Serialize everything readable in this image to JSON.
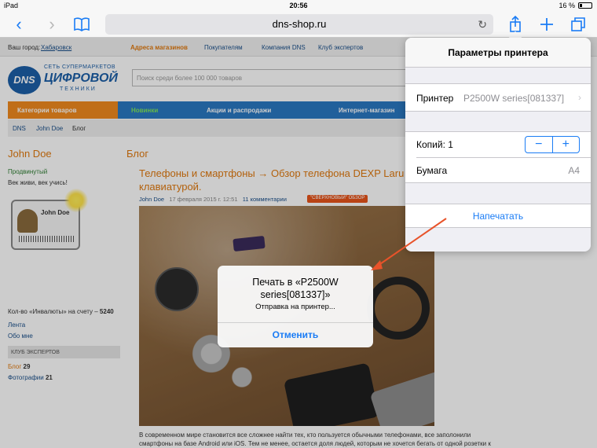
{
  "status_bar": {
    "device": "iPad",
    "time": "20:56",
    "battery": "16 %"
  },
  "browser": {
    "url": "dns-shop.ru",
    "icons": [
      "back-icon",
      "forward-icon",
      "bookmarks-icon",
      "reload-icon",
      "share-icon",
      "new-tab-icon",
      "tabs-icon"
    ]
  },
  "webpage": {
    "topnav": {
      "city_label": "Ваш город:",
      "city": "Хабаровск",
      "items": [
        "Адреса магазинов",
        "Покупателям",
        "Компания DNS",
        "Клуб экспертов"
      ]
    },
    "logo": {
      "brand": "DNS",
      "line1": "СЕТЬ СУПЕРМАРКЕТОВ",
      "line2": "ЦИФРОВОЙ",
      "line3": "ТЕХНИКИ"
    },
    "search_placeholder": "Поиск среди более 100 000 товаров",
    "menu": [
      "Категории товаров",
      "Новинки",
      "Акции и распродажи",
      "Интернет-магазин"
    ],
    "breadcrumbs": [
      "DNS",
      "John Doe",
      "Блог"
    ],
    "sidebar": {
      "name": "John Doe",
      "rank": "Продвинутый",
      "motto": "Век живи, век учись!",
      "card_name": "John Doe",
      "invaluts": "Кол-во «Инвалюты» на счету –",
      "invaluts_count": "5240",
      "links": [
        "Лента",
        "Обо мне"
      ],
      "club_heading": "КЛУБ ЭКСПЕРТОВ",
      "club_items": [
        {
          "label": "Блог",
          "count": "29"
        },
        {
          "label": "Фотографии",
          "count": "21"
        }
      ]
    },
    "blog": {
      "section_title": "Блог",
      "post_title": "Телефоны и смартфоны → Обзор телефона DEXP Laru",
      "post_title_cont": "клавиатурой.",
      "author": "John Doe",
      "date": "17 февраля 2015 г. 12:51",
      "comments": "11 комментарии",
      "badge": "\"СВЕРХНОВЫЙ\" ОБЗОР",
      "para_line1": "В современном мире становится все сложнее найти тех, кто пользуется обычными телефонами, все заполонили",
      "para_line2": "смартфоны на базе Android или iOS. Тем не менее, остается доля людей, которым не хочется бегать от одной розетки к"
    }
  },
  "print_popover": {
    "title": "Параметры принтера",
    "printer_label": "Принтер",
    "printer_value": "P2500W series[081337]",
    "copies_label": "Копий: 1",
    "minus": "−",
    "plus": "+",
    "paper_label": "Бумага",
    "paper_value": "A4",
    "print_button": "Напечатать"
  },
  "print_alert": {
    "title": "Печать в «P2500W series[081337]»",
    "message": "Отправка на принтер...",
    "cancel": "Отменить"
  },
  "colors": {
    "ios_blue": "#1a7cf5",
    "dns_orange": "#e07a10",
    "arrow": "#e8532a"
  }
}
